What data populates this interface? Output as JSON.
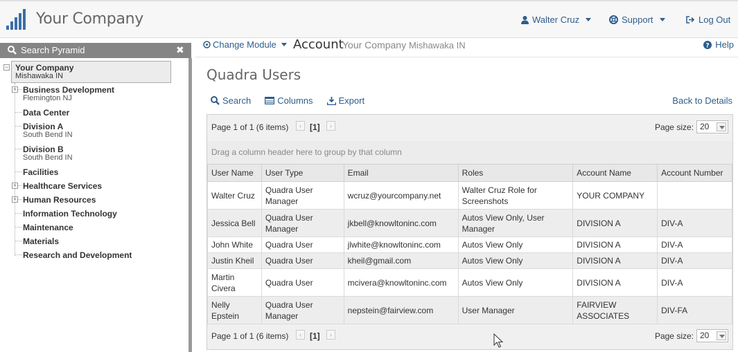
{
  "header": {
    "company": "Your Company",
    "user": "Walter Cruz",
    "support": "Support",
    "logout": "Log Out"
  },
  "sidebar": {
    "search_label": "Search Pyramid",
    "root": {
      "name": "Your Company",
      "location": "Mishawaka IN"
    },
    "nodes": [
      {
        "name": "Business Development",
        "location": "Flemington NJ",
        "expandable": true
      },
      {
        "name": "Data Center",
        "location": "",
        "expandable": false
      },
      {
        "name": "Division A",
        "location": "South Bend IN",
        "expandable": false
      },
      {
        "name": "Division B",
        "location": "South Bend IN",
        "expandable": false
      },
      {
        "name": "Facilities",
        "location": "",
        "expandable": false
      },
      {
        "name": "Healthcare Services",
        "location": "",
        "expandable": true
      },
      {
        "name": "Human Resources",
        "location": "",
        "expandable": true
      },
      {
        "name": "Information Technology",
        "location": "",
        "expandable": false
      },
      {
        "name": "Maintenance",
        "location": "",
        "expandable": false
      },
      {
        "name": "Materials",
        "location": "",
        "expandable": false
      },
      {
        "name": "Research and Development",
        "location": "",
        "expandable": false
      }
    ]
  },
  "subbar": {
    "change_module": "Change Module",
    "title": "Account",
    "company": "Your Company",
    "location": "Mishawaka IN",
    "help": "Help"
  },
  "page": {
    "title": "Quadra Users",
    "toolbar": {
      "search": "Search",
      "columns": "Columns",
      "export": "Export"
    },
    "back": "Back to Details"
  },
  "grid": {
    "pager_info": "Page 1 of 1 (6 items)",
    "current_page": "[1]",
    "page_size_label": "Page size:",
    "page_size": "20",
    "group_hint": "Drag a column header here to group by that column",
    "columns": [
      "User Name",
      "User Type",
      "Email",
      "Roles",
      "Account Name",
      "Account Number"
    ],
    "rows": [
      [
        "Walter Cruz",
        "Quadra User Manager",
        "wcruz@yourcompany.net",
        "Walter Cruz Role for Screenshots",
        "YOUR COMPANY",
        ""
      ],
      [
        "Jessica Bell",
        "Quadra User Manager",
        "jkbell@knowltoninc.com",
        "Autos View Only, User Manager",
        "DIVISION A",
        "DIV-A"
      ],
      [
        "John White",
        "Quadra User",
        "jlwhite@knowltoninc.com",
        "Autos View Only",
        "DIVISION A",
        "DIV-A"
      ],
      [
        "Justin Kheil",
        "Quadra User",
        "kheil@gmail.com",
        "Autos View Only",
        "DIVISION A",
        "DIV-A"
      ],
      [
        "Martin Civera",
        "Quadra User",
        "mcivera@knowltoninc.com",
        "Autos View Only",
        "DIVISION A",
        "DIV-A"
      ],
      [
        "Nelly Epstein",
        "Quadra User Manager",
        "nepstein@fairview.com",
        "User Manager",
        "FAIRVIEW ASSOCIATES",
        "DIV-FA"
      ]
    ]
  }
}
